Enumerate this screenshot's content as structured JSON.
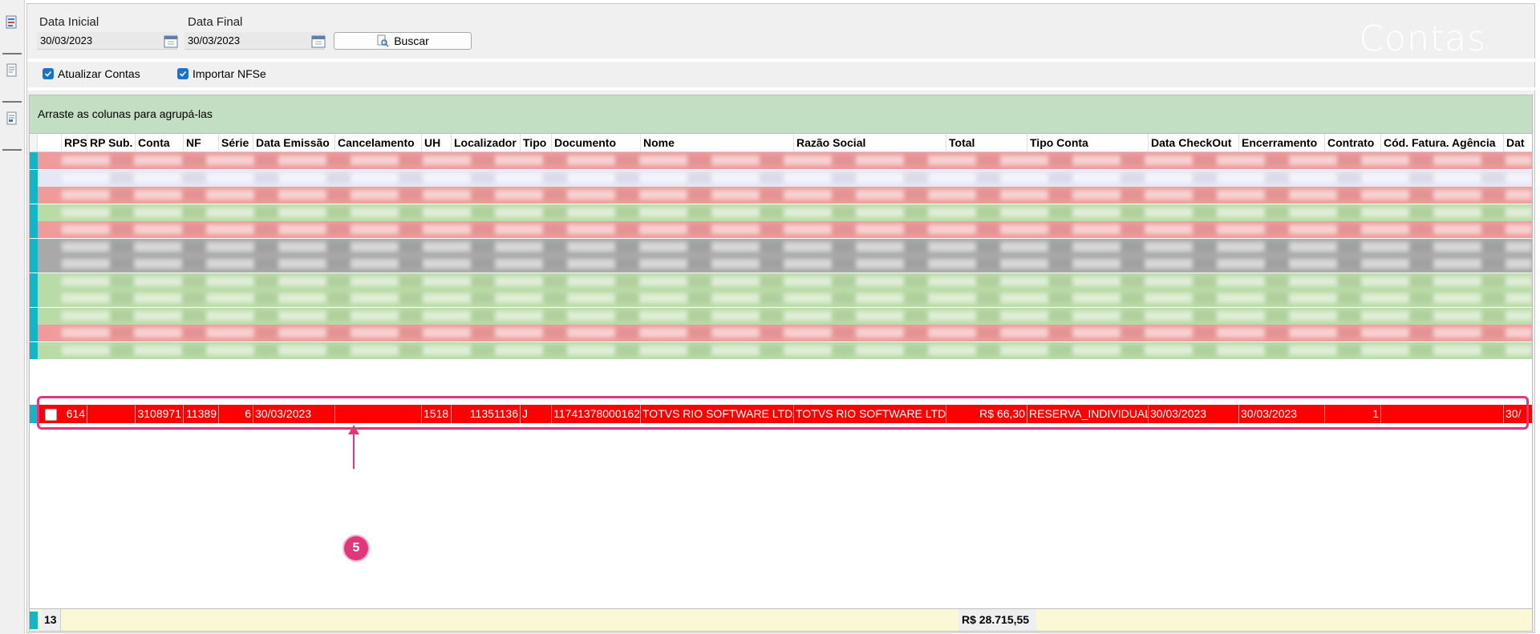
{
  "window": {
    "title": "Contas"
  },
  "filters": {
    "data_inicial_label": "Data Inicial",
    "data_inicial_value": "30/03/2023",
    "data_final_label": "Data Final",
    "data_final_value": "30/03/2023",
    "buscar_label": "Buscar"
  },
  "options": {
    "atualizar_contas": {
      "label": "Atualizar Contas",
      "checked": true
    },
    "importar_nfse": {
      "label": "Importar NFSe",
      "checked": true
    }
  },
  "grid": {
    "group_hint": "Arraste as colunas para agrupá-las",
    "columns": [
      "RPS",
      "RP Sub.",
      "Conta",
      "NF",
      "Série",
      "Data Emissão",
      "Cancelamento",
      "UH",
      "Localizador",
      "Tipo",
      "Documento",
      "Nome",
      "Razão Social",
      "Total",
      "Tipo Conta",
      "Data CheckOut",
      "Encerramento",
      "Contrato",
      "Cód. Fatura. Agência",
      "Dat"
    ],
    "blurred_row_colors": [
      "#ef9b9b",
      "#e6e6f5",
      "#ef9b9b",
      "#b9dba6",
      "#ef9b9b",
      "#a9a9a9",
      "#a9a9a9",
      "#b9dba6",
      "#b9dba6",
      "#b9dba6",
      "#ef9b9b",
      "#b9dba6"
    ],
    "selected_row": {
      "rps": "614",
      "rp_sub": "",
      "conta": "3108971",
      "nf": "11389",
      "serie": "6",
      "data_emissao": "30/03/2023",
      "cancelamento": "",
      "uh": "1518",
      "localizador": "11351136",
      "tipo": "J",
      "documento": "11741378000162",
      "nome": "TOTVS RIO SOFTWARE LTDA",
      "razao_social": "TOTVS RIO SOFTWARE LTDA",
      "total": "R$ 66,30",
      "tipo_conta": "RESERVA_INDIVIDUAL",
      "data_checkout": "30/03/2023",
      "encerramento": "30/03/2023",
      "contrato": "1",
      "cod_fatura_agencia": "",
      "dat": "30/"
    },
    "footer": {
      "count": "13",
      "total": "R$ 28.715,55"
    }
  },
  "annotation": {
    "step_number": "5",
    "color": "#e0377b"
  },
  "colors": {
    "row_indicator": "#14b5c6",
    "selected_row": "#ff0000",
    "group_bar": "#c2dec3",
    "footer": "#fbf8d5"
  }
}
